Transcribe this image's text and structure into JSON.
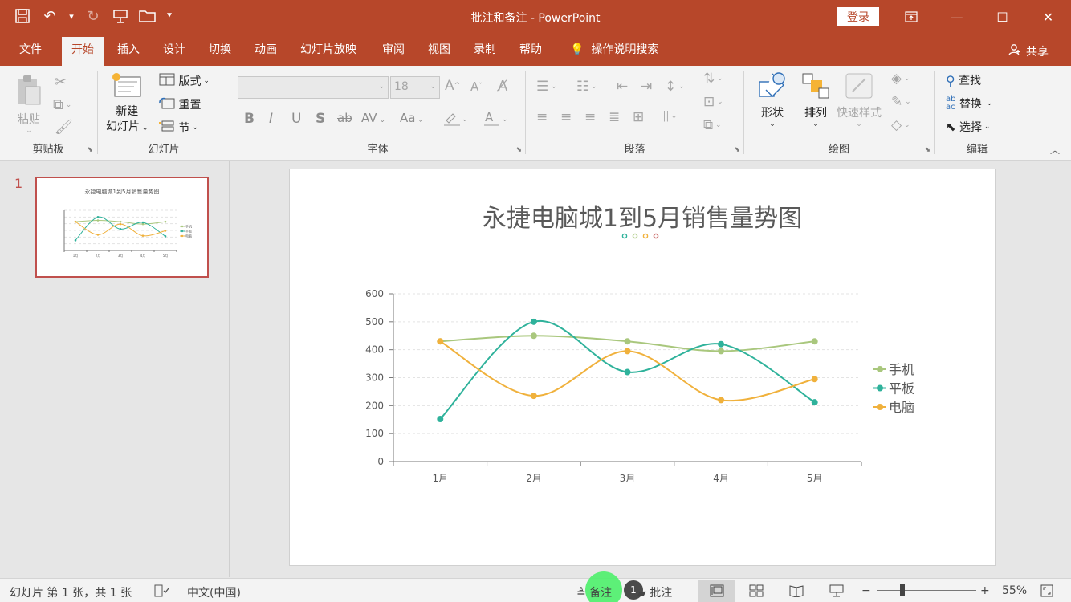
{
  "app": {
    "title": "批注和备注  -  PowerPoint",
    "login_label": "登录",
    "share_label": "共享"
  },
  "tabs": [
    "文件",
    "开始",
    "插入",
    "设计",
    "切换",
    "动画",
    "幻灯片放映",
    "审阅",
    "视图",
    "录制",
    "帮助"
  ],
  "active_tab": "开始",
  "search_hint": "操作说明搜索",
  "ribbon": {
    "clipboard": {
      "label": "剪贴板",
      "paste": "粘贴"
    },
    "slides": {
      "label": "幻灯片",
      "new_slide_1": "新建",
      "new_slide_2": "幻灯片",
      "layout": "版式",
      "reset": "重置",
      "section": "节"
    },
    "font": {
      "label": "字体",
      "size": "18"
    },
    "paragraph": {
      "label": "段落"
    },
    "drawing": {
      "label": "绘图",
      "shapes": "形状",
      "arrange": "排列",
      "quick_styles": "快速样式"
    },
    "editing": {
      "label": "编辑",
      "find": "查找",
      "replace": "替换",
      "select": "选择"
    }
  },
  "slide_panel": {
    "number": "1",
    "thumb_title": "永捷电脑城1到5月销售量势图"
  },
  "chart_data": {
    "type": "line",
    "title": "永捷电脑城1到5月销售量势图",
    "categories": [
      "1月",
      "2月",
      "3月",
      "4月",
      "5月"
    ],
    "series": [
      {
        "name": "手机",
        "color": "#a9c77d",
        "values": [
          430,
          450,
          430,
          395,
          430
        ]
      },
      {
        "name": "平板",
        "color": "#2fb29b",
        "values": [
          152,
          500,
          320,
          420,
          212
        ]
      },
      {
        "name": "电脑",
        "color": "#f0b13c",
        "values": [
          430,
          235,
          395,
          220,
          295
        ]
      }
    ],
    "ylim": [
      0,
      600
    ],
    "yticks": [
      "0",
      "100",
      "200",
      "300",
      "400",
      "500",
      "600"
    ],
    "smooth": true,
    "legend": "right",
    "grid": "horizontal dashed",
    "deco_colors": [
      "#2fb29b",
      "#a9c77d",
      "#f0b13c",
      "#c0504d"
    ]
  },
  "status": {
    "slide_info": "幻灯片 第 1 张，共 1 张",
    "language": "中文(中国)",
    "notes": "备注",
    "comments_count": "1",
    "comments": "批注",
    "zoom": "55%"
  }
}
